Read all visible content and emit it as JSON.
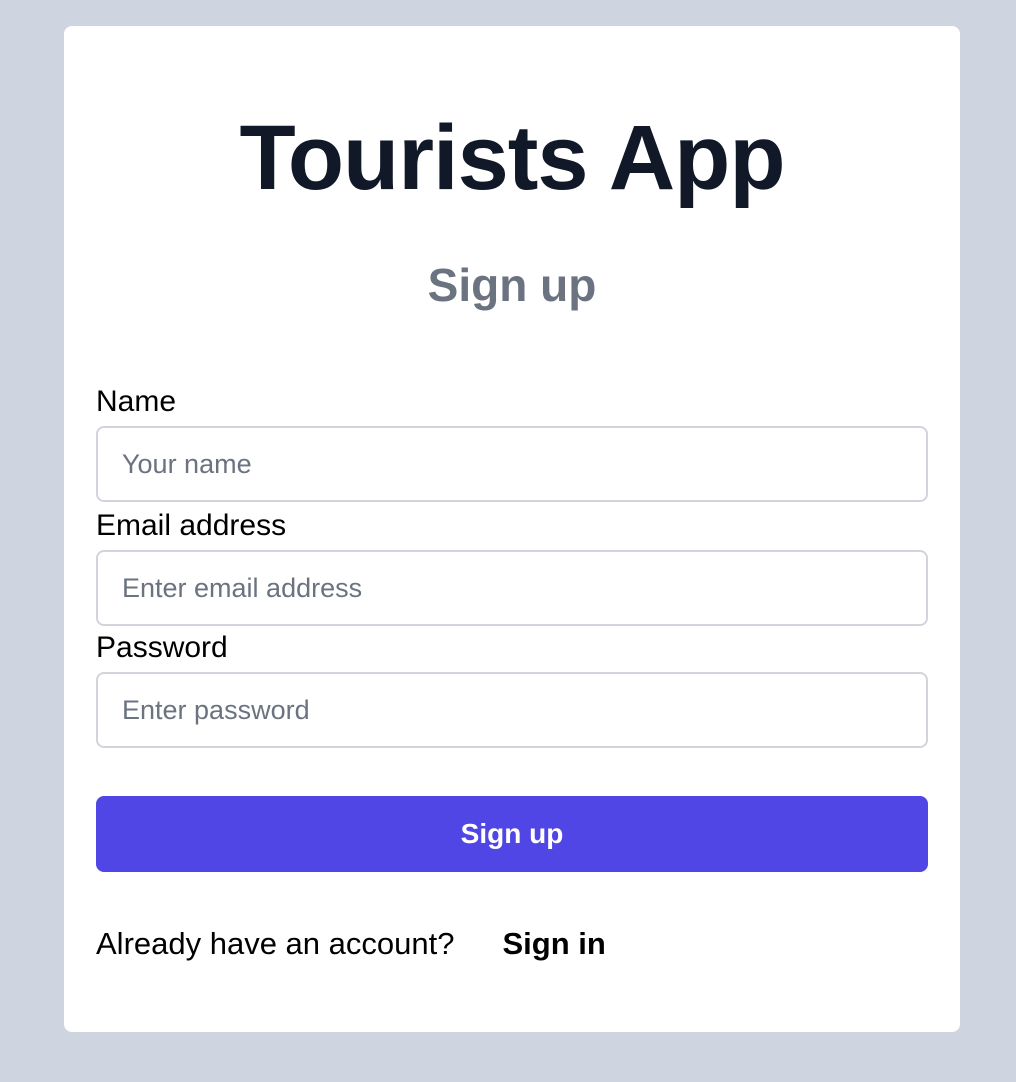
{
  "app": {
    "title": "Tourists App"
  },
  "form": {
    "heading": "Sign up",
    "fields": [
      {
        "label": "Name",
        "placeholder": "Your name",
        "value": ""
      },
      {
        "label": "Email address",
        "placeholder": "Enter email address",
        "value": ""
      },
      {
        "label": "Password",
        "placeholder": "Enter password",
        "value": ""
      }
    ],
    "submit_label": "Sign up",
    "footer_text": "Already have an account?",
    "signin_label": "Sign in"
  },
  "colors": {
    "page_background": "#cfd5e0",
    "card_background": "#ffffff",
    "title": "#111827",
    "subtitle": "#6b7280",
    "accent": "#4f46e5",
    "input_border": "#d1d5db"
  }
}
